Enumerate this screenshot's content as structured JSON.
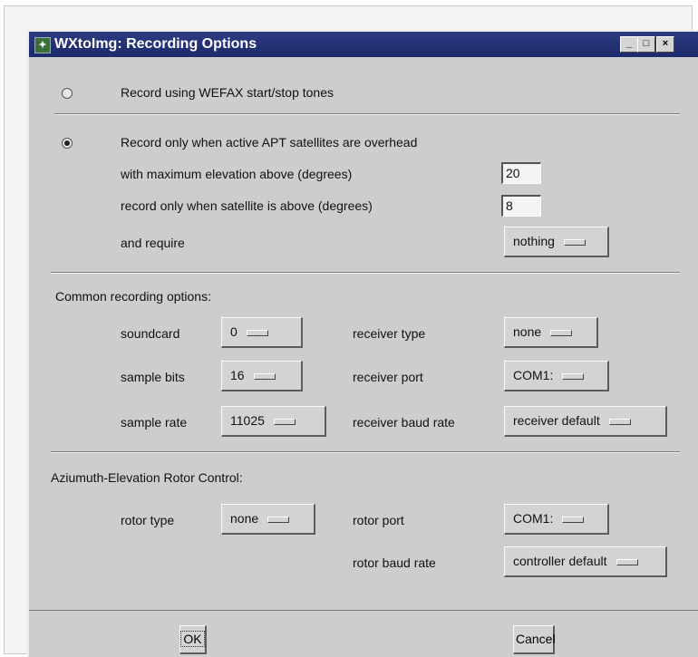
{
  "window": {
    "title": "WXtoImg: Recording Options",
    "controls": [
      "_",
      "□",
      "×"
    ]
  },
  "mode": {
    "wefax_label": "Record using WEFAX start/stop tones",
    "wefax_selected": false,
    "apt_label": "Record only when active APT satellites are overhead",
    "apt_selected": true,
    "max_elev_label": "with maximum elevation above (degrees)",
    "max_elev_value": "20",
    "min_elev_label": "record only when satellite is above (degrees)",
    "min_elev_value": "8",
    "require_label": "and require",
    "require_value": "nothing"
  },
  "common": {
    "heading": "Common recording options:",
    "soundcard_label": "soundcard",
    "soundcard_value": "0",
    "sample_bits_label": "sample bits",
    "sample_bits_value": "16",
    "sample_rate_label": "sample rate",
    "sample_rate_value": "11025",
    "receiver_type_label": "receiver type",
    "receiver_type_value": "none",
    "receiver_port_label": "receiver port",
    "receiver_port_value": "COM1:",
    "receiver_baud_label": "receiver baud rate",
    "receiver_baud_value": "receiver default"
  },
  "rotor": {
    "heading": "Aziumuth-Elevation Rotor Control:",
    "type_label": "rotor type",
    "type_value": "none",
    "port_label": "rotor port",
    "port_value": "COM1:",
    "baud_label": "rotor baud rate",
    "baud_value": "controller default"
  },
  "buttons": {
    "ok": "OK",
    "cancel": "Cancel"
  }
}
